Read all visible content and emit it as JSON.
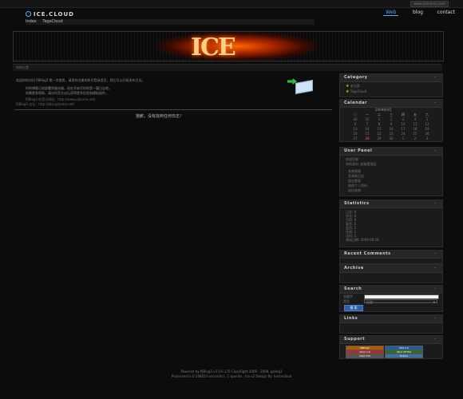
{
  "topbar": {
    "link": "www.sitename.com"
  },
  "header": {
    "logo": "ICE.CLOUD",
    "subnav": [
      "Index",
      "TagsCloud"
    ],
    "nav": [
      "Web",
      "blog",
      "contact"
    ]
  },
  "banner": {
    "title": "ICE",
    "strip_text": "你的位置"
  },
  "post": {
    "lines": [
      "欢迎你的访问 PJBlog3 第一次使用，请用你注册的账号登录首页，然后可以开始发布日志。",
      "你的博客已经部署到服务器，现在开始写你的第一篇日志吧。",
      "如需更多帮助，请访问官方论坛获得更多信息和模板插件。",
      "PJBlog3 的官方网站：http://www.pjhome.net/",
      "PJBlog3 论坛：http://bbs.pjhome.net/"
    ],
    "notice": "抱歉，没有找到任何日志！"
  },
  "sidebar": {
    "category": {
      "title": "Category",
      "items": [
        "未分类",
        "TagsCloud"
      ]
    },
    "calendar": {
      "title": "Calendar",
      "month": "2009年9月",
      "weekdays": [
        "日",
        "一",
        "二",
        "三",
        "四",
        "五",
        "六"
      ],
      "weeks": [
        [
          "30",
          "31",
          "1",
          "2",
          "3",
          "4",
          "5"
        ],
        [
          "6",
          "7",
          "8",
          "9",
          "10",
          "11",
          "12"
        ],
        [
          "13",
          "14",
          "15",
          "16",
          "17",
          "18",
          "19"
        ],
        [
          "20",
          "21",
          "22",
          "23",
          "24",
          "25",
          "26"
        ],
        [
          "27",
          "28",
          "29",
          "30",
          "1",
          "2",
          "3"
        ]
      ]
    },
    "user_panel": {
      "title": "User Panel",
      "lines": [
        "欢迎回来",
        "你的身份: 超级管理员"
      ],
      "links": [
        "系统管理",
        "发表新日志",
        "退出登录",
        "修改个人资料",
        "退出系统"
      ]
    },
    "statistics": {
      "title": "Statistics",
      "lines": [
        "日志: 0",
        "评论: 0",
        "引用: 0",
        "留言: 0",
        "会员: 1",
        "在线: 1",
        "访问: 1",
        "建站日期: 2009.09.28"
      ]
    },
    "recent_comments": {
      "title": "Recent Comments"
    },
    "archive": {
      "title": "Archive"
    },
    "search": {
      "title": "Search",
      "label1": "关键字",
      "label2": "类型",
      "select_value": "日志",
      "button": "搜 索"
    },
    "links": {
      "title": "Links"
    },
    "support": {
      "title": "Support",
      "badges": [
        "PJBlog3",
        "RSS 2.0",
        "Atom 1.0",
        "Valid XHTML",
        "Valid CSS",
        "Firefox"
      ]
    }
  },
  "footer": {
    "line1": "Powered by PJBlog3 v3.0.6.170 CopyRight 2009 - 2008, pjblog3",
    "line2": "Processed in 0.148023 second(s) , 1 queries , Ice v2 Design By: Iceicecloud"
  },
  "colors": {
    "accent": "#1a8cff",
    "background": "#0c0c0c",
    "widget": "#1b1b1b"
  }
}
